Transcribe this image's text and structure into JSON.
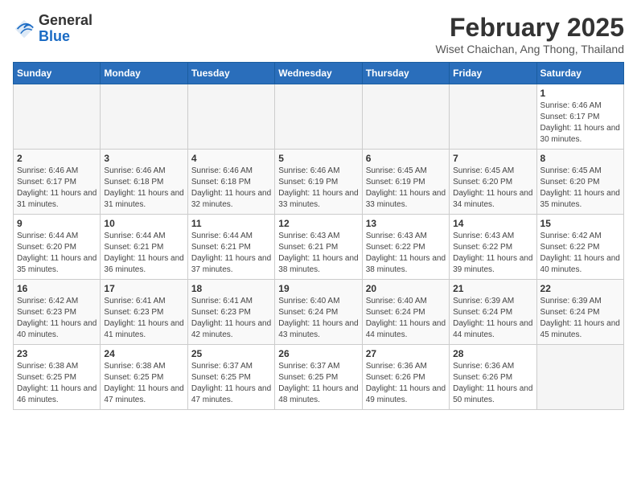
{
  "header": {
    "logo_general": "General",
    "logo_blue": "Blue",
    "month_title": "February 2025",
    "subtitle": "Wiset Chaichan, Ang Thong, Thailand"
  },
  "calendar": {
    "days_of_week": [
      "Sunday",
      "Monday",
      "Tuesday",
      "Wednesday",
      "Thursday",
      "Friday",
      "Saturday"
    ],
    "weeks": [
      [
        {
          "num": "",
          "info": ""
        },
        {
          "num": "",
          "info": ""
        },
        {
          "num": "",
          "info": ""
        },
        {
          "num": "",
          "info": ""
        },
        {
          "num": "",
          "info": ""
        },
        {
          "num": "",
          "info": ""
        },
        {
          "num": "1",
          "info": "Sunrise: 6:46 AM\nSunset: 6:17 PM\nDaylight: 11 hours and 30 minutes."
        }
      ],
      [
        {
          "num": "2",
          "info": "Sunrise: 6:46 AM\nSunset: 6:17 PM\nDaylight: 11 hours and 31 minutes."
        },
        {
          "num": "3",
          "info": "Sunrise: 6:46 AM\nSunset: 6:18 PM\nDaylight: 11 hours and 31 minutes."
        },
        {
          "num": "4",
          "info": "Sunrise: 6:46 AM\nSunset: 6:18 PM\nDaylight: 11 hours and 32 minutes."
        },
        {
          "num": "5",
          "info": "Sunrise: 6:46 AM\nSunset: 6:19 PM\nDaylight: 11 hours and 33 minutes."
        },
        {
          "num": "6",
          "info": "Sunrise: 6:45 AM\nSunset: 6:19 PM\nDaylight: 11 hours and 33 minutes."
        },
        {
          "num": "7",
          "info": "Sunrise: 6:45 AM\nSunset: 6:20 PM\nDaylight: 11 hours and 34 minutes."
        },
        {
          "num": "8",
          "info": "Sunrise: 6:45 AM\nSunset: 6:20 PM\nDaylight: 11 hours and 35 minutes."
        }
      ],
      [
        {
          "num": "9",
          "info": "Sunrise: 6:44 AM\nSunset: 6:20 PM\nDaylight: 11 hours and 35 minutes."
        },
        {
          "num": "10",
          "info": "Sunrise: 6:44 AM\nSunset: 6:21 PM\nDaylight: 11 hours and 36 minutes."
        },
        {
          "num": "11",
          "info": "Sunrise: 6:44 AM\nSunset: 6:21 PM\nDaylight: 11 hours and 37 minutes."
        },
        {
          "num": "12",
          "info": "Sunrise: 6:43 AM\nSunset: 6:21 PM\nDaylight: 11 hours and 38 minutes."
        },
        {
          "num": "13",
          "info": "Sunrise: 6:43 AM\nSunset: 6:22 PM\nDaylight: 11 hours and 38 minutes."
        },
        {
          "num": "14",
          "info": "Sunrise: 6:43 AM\nSunset: 6:22 PM\nDaylight: 11 hours and 39 minutes."
        },
        {
          "num": "15",
          "info": "Sunrise: 6:42 AM\nSunset: 6:22 PM\nDaylight: 11 hours and 40 minutes."
        }
      ],
      [
        {
          "num": "16",
          "info": "Sunrise: 6:42 AM\nSunset: 6:23 PM\nDaylight: 11 hours and 40 minutes."
        },
        {
          "num": "17",
          "info": "Sunrise: 6:41 AM\nSunset: 6:23 PM\nDaylight: 11 hours and 41 minutes."
        },
        {
          "num": "18",
          "info": "Sunrise: 6:41 AM\nSunset: 6:23 PM\nDaylight: 11 hours and 42 minutes."
        },
        {
          "num": "19",
          "info": "Sunrise: 6:40 AM\nSunset: 6:24 PM\nDaylight: 11 hours and 43 minutes."
        },
        {
          "num": "20",
          "info": "Sunrise: 6:40 AM\nSunset: 6:24 PM\nDaylight: 11 hours and 44 minutes."
        },
        {
          "num": "21",
          "info": "Sunrise: 6:39 AM\nSunset: 6:24 PM\nDaylight: 11 hours and 44 minutes."
        },
        {
          "num": "22",
          "info": "Sunrise: 6:39 AM\nSunset: 6:24 PM\nDaylight: 11 hours and 45 minutes."
        }
      ],
      [
        {
          "num": "23",
          "info": "Sunrise: 6:38 AM\nSunset: 6:25 PM\nDaylight: 11 hours and 46 minutes."
        },
        {
          "num": "24",
          "info": "Sunrise: 6:38 AM\nSunset: 6:25 PM\nDaylight: 11 hours and 47 minutes."
        },
        {
          "num": "25",
          "info": "Sunrise: 6:37 AM\nSunset: 6:25 PM\nDaylight: 11 hours and 47 minutes."
        },
        {
          "num": "26",
          "info": "Sunrise: 6:37 AM\nSunset: 6:25 PM\nDaylight: 11 hours and 48 minutes."
        },
        {
          "num": "27",
          "info": "Sunrise: 6:36 AM\nSunset: 6:26 PM\nDaylight: 11 hours and 49 minutes."
        },
        {
          "num": "28",
          "info": "Sunrise: 6:36 AM\nSunset: 6:26 PM\nDaylight: 11 hours and 50 minutes."
        },
        {
          "num": "",
          "info": ""
        }
      ]
    ]
  }
}
